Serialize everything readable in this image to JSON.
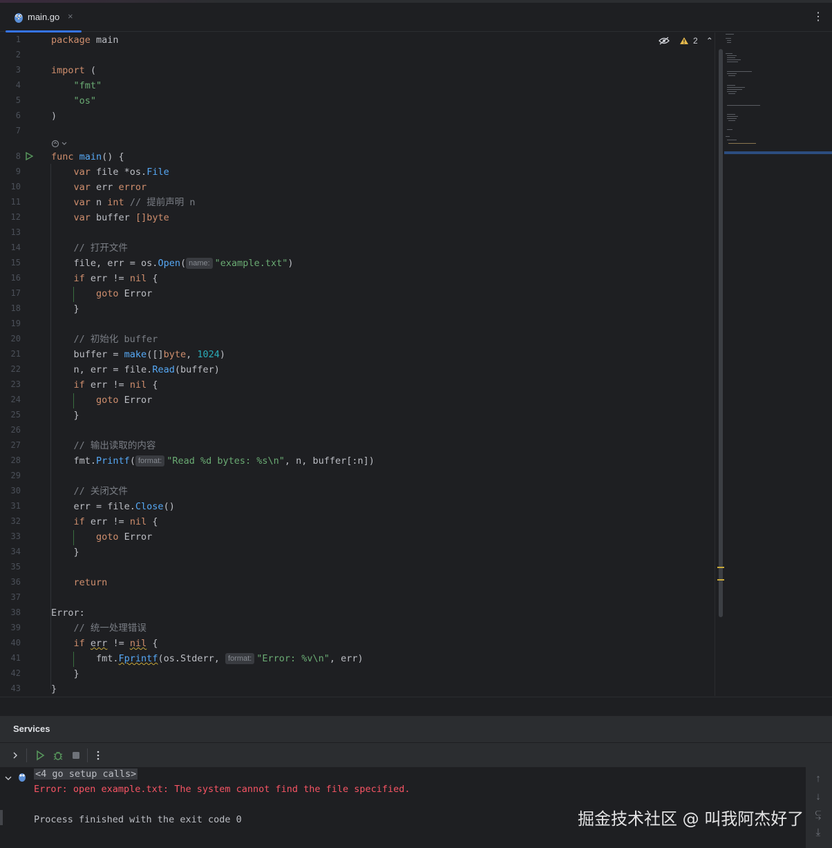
{
  "tab": {
    "filename": "main.go",
    "close": "×"
  },
  "inspection": {
    "warnings": "2"
  },
  "gutter": {
    "lines": [
      "1",
      "2",
      "3",
      "4",
      "5",
      "6",
      "7",
      "8",
      "9",
      "10",
      "11",
      "12",
      "13",
      "14",
      "15",
      "16",
      "17",
      "18",
      "19",
      "20",
      "21",
      "22",
      "23",
      "24",
      "25",
      "26",
      "27",
      "28",
      "29",
      "30",
      "31",
      "32",
      "33",
      "34",
      "35",
      "36",
      "37",
      "38",
      "39",
      "40",
      "41",
      "42",
      "43"
    ]
  },
  "code": {
    "l1a": "package",
    "l1b": " main",
    "l3a": "import",
    "l3b": " (",
    "l4": "    \"fmt\"",
    "l5": "    \"os\"",
    "l6": ")",
    "l8a": "func",
    "l8b": " ",
    "l8c": "main",
    "l8d": "() {",
    "l9a": "    var",
    "l9b": " file *os.",
    "l9c": "File",
    "l10a": "    var",
    "l10b": " err ",
    "l10c": "error",
    "l11a": "    var",
    "l11b": " n ",
    "l11c": "int",
    "l11d": " // 提前声明 n",
    "l12a": "    var",
    "l12b": " buffer ",
    "l12c": "[]byte",
    "l14": "    // 打开文件",
    "l15a": "    file, err = os.",
    "l15b": "Open",
    "l15c": "(",
    "l15hint": "name:",
    "l15d": "\"example.txt\"",
    "l15e": ")",
    "l16a": "    if",
    "l16b": " err != ",
    "l16c": "nil",
    "l16d": " {",
    "l17a": "        goto",
    "l17b": " Error",
    "l18": "    }",
    "l20": "    // 初始化 buffer",
    "l21a": "    buffer = ",
    "l21b": "make",
    "l21c": "([]",
    "l21d": "byte",
    "l21e": ", ",
    "l21f": "1024",
    "l21g": ")",
    "l22a": "    n, err = file.",
    "l22b": "Read",
    "l22c": "(buffer)",
    "l23a": "    if",
    "l23b": " err != ",
    "l23c": "nil",
    "l23d": " {",
    "l24a": "        goto",
    "l24b": " Error",
    "l25": "    }",
    "l27": "    // 输出读取的内容",
    "l28a": "    fmt.",
    "l28b": "Printf",
    "l28c": "(",
    "l28hint": "format:",
    "l28d": "\"Read %d bytes: %s\\n\"",
    "l28e": ", n, buffer[:n])",
    "l30": "    // 关闭文件",
    "l31a": "    err = file.",
    "l31b": "Close",
    "l31c": "()",
    "l32a": "    if",
    "l32b": " err != ",
    "l32c": "nil",
    "l32d": " {",
    "l33a": "        goto",
    "l33b": " Error",
    "l34": "    }",
    "l36": "    return",
    "l38": "Error:",
    "l39": "    // 统一处理错误",
    "l40a": "    if",
    "l40b": " ",
    "l40c": "err",
    "l40d": " != ",
    "l40e": "nil",
    "l40f": " {",
    "l41a": "        fmt.",
    "l41b": "Fprintf",
    "l41c": "(os.Stderr, ",
    "l41hint": "format:",
    "l41d": "\"Error: %v\\n\"",
    "l41e": ", err)",
    "l42": "    }",
    "l43": "}"
  },
  "services": {
    "title": "Services",
    "output": {
      "meta": "<4 go setup calls>",
      "error": "Error: open example.txt: The system cannot find the file specified.",
      "finished": "Process finished with the exit code 0"
    }
  },
  "watermark": "掘金技术社区 @ 叫我阿杰好了",
  "colors": {
    "accent": "#3574f0",
    "keyword": "#cf8e6d",
    "string": "#6aab73",
    "number": "#2aacb8",
    "error": "#f75464"
  }
}
